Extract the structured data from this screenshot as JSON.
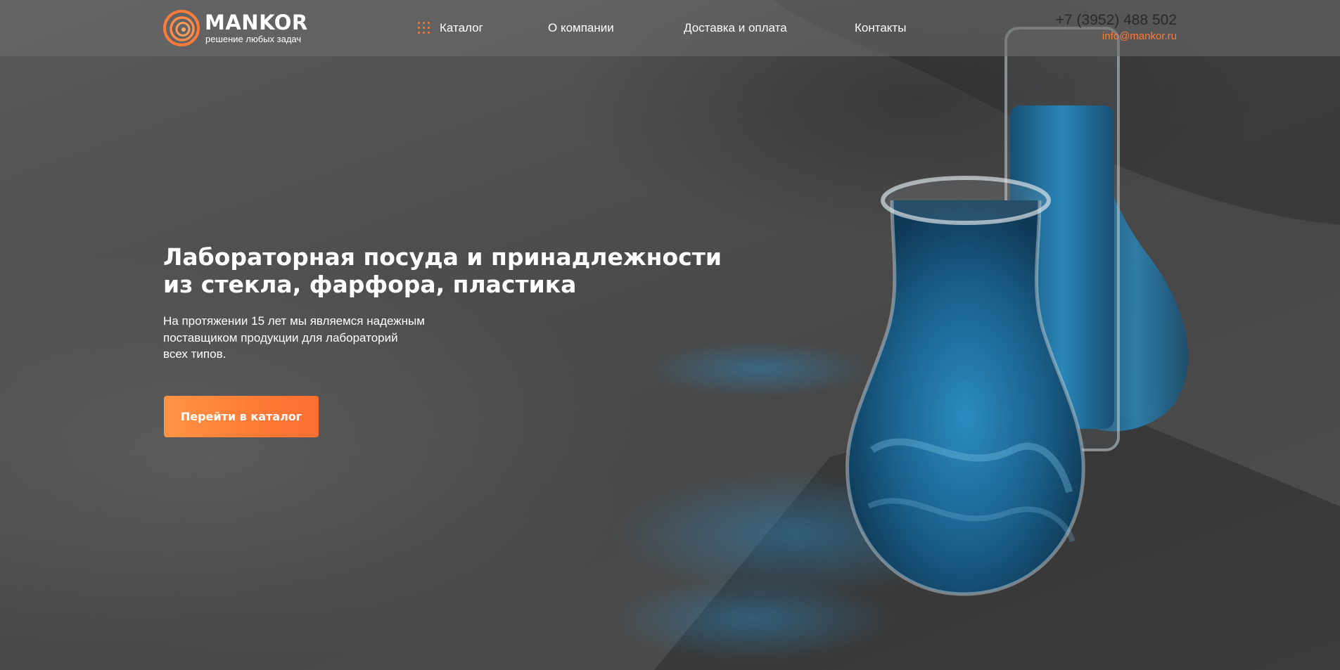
{
  "brand": {
    "name": "MANKOR",
    "tagline": "решение любых задач",
    "logo_icon": "concentric-rings-logo",
    "accent_color": "#ff7b3a"
  },
  "nav": {
    "catalog_icon": "grid-dots-icon",
    "items": [
      {
        "label": "Каталог"
      },
      {
        "label": "О компании"
      },
      {
        "label": "Доставка и оплата"
      },
      {
        "label": "Контакты"
      }
    ]
  },
  "contacts": {
    "phone": "+7 (3952) 488 502",
    "email": "info@mankor.ru"
  },
  "hero": {
    "title_lines": [
      "Лабораторная посуда и принадлежности",
      "из стекла, фарфора, пластика"
    ],
    "description_lines": [
      "На протяжении 15 лет мы являемся надежным",
      "поставщиком продукции для лабораторий",
      "всех типов."
    ],
    "cta_label": "Перейти в каталог",
    "image": "blue-liquid-laboratory-flasks-photo",
    "liquid_color": "#1f6f9a"
  }
}
